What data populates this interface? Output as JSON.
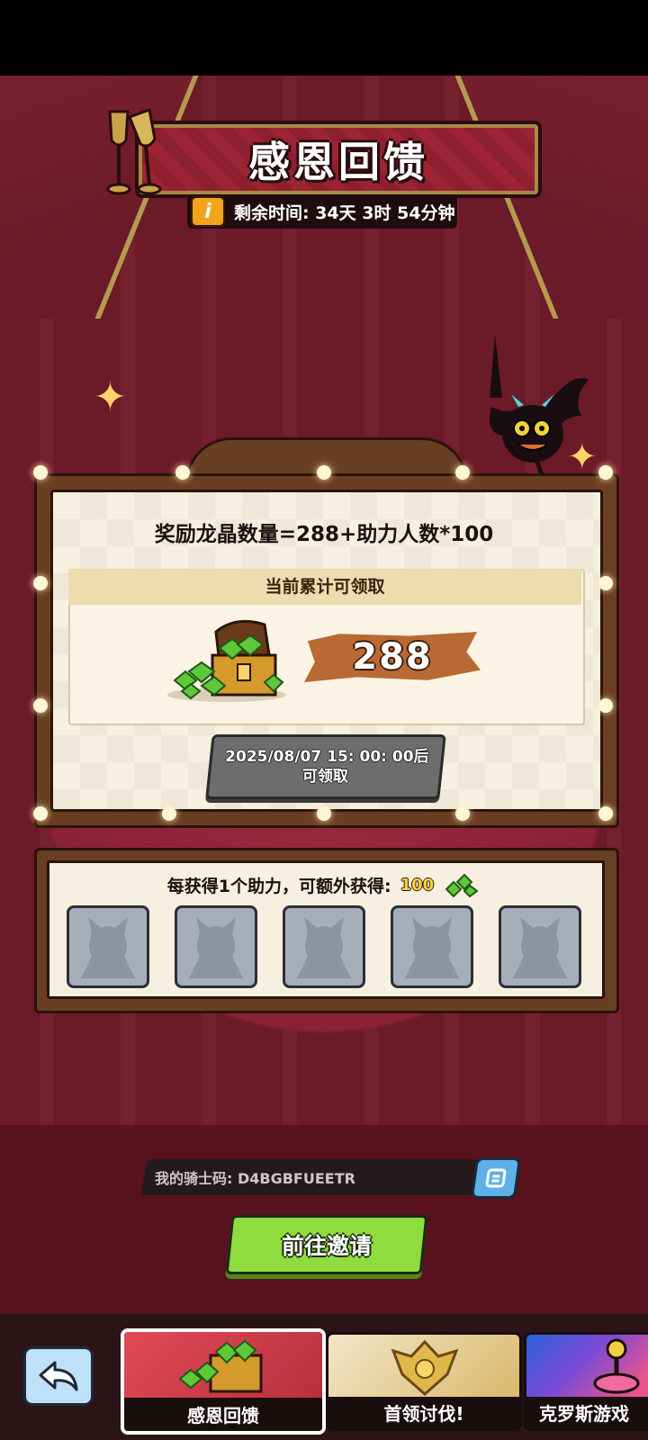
{
  "header": {
    "title": "感恩回馈",
    "remaining_time": "剩余时间: 34天 3时 54分钟",
    "info_icon": "info-icon"
  },
  "reward": {
    "formula": "奖励龙晶数量=288+助力人数*100",
    "accumulated_label": "当前累计可领取",
    "accumulated_value": "288",
    "claim_line1": "2025/08/07 15: 00: 00后",
    "claim_line2": "可领取"
  },
  "helpers": {
    "bonus_text": "每获得1个助力，可额外获得:",
    "bonus_amount": "100",
    "slot_count": 5
  },
  "invite": {
    "knight_code": "我的骑士码: D4BGBFUEETR",
    "invite_button": "前往邀请"
  },
  "tabs": [
    {
      "label": "感恩回馈",
      "active": true
    },
    {
      "label": "首领讨伐!",
      "active": false
    },
    {
      "label": "克罗斯游戏",
      "active": false
    }
  ],
  "colors": {
    "stage": "#6b1a28",
    "board": "#f7efdf",
    "value_brush": "#b96a34",
    "invite_button": "#8fdc3e",
    "claim_button_disabled": "#6d6d6d"
  }
}
